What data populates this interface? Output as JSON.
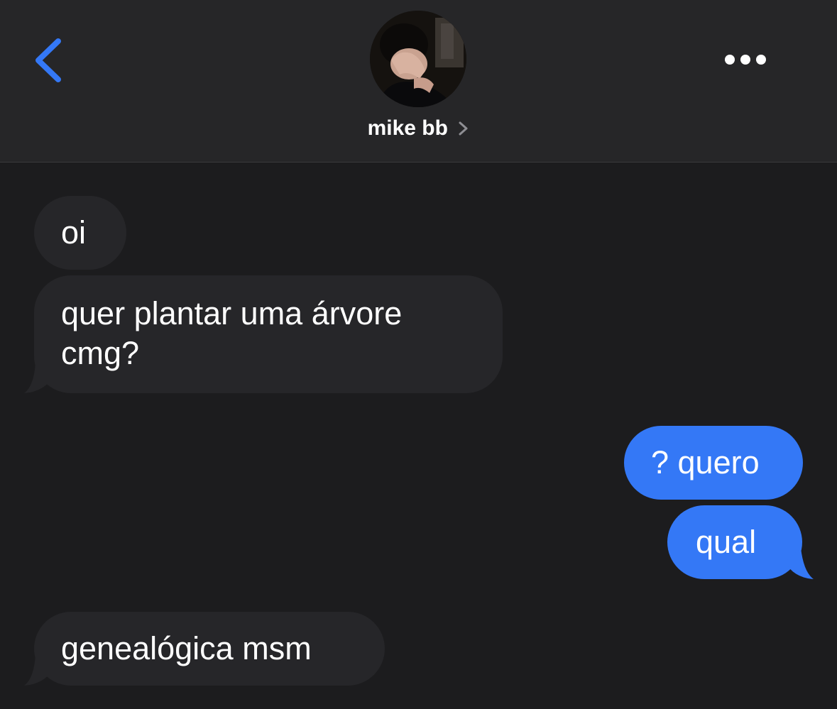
{
  "header": {
    "contact_name": "mike bb",
    "icons": {
      "back": "chevron-left-icon",
      "more": "ellipsis-icon",
      "name_chevron": "chevron-right-icon"
    }
  },
  "colors": {
    "background": "#1c1c1e",
    "header_background": "#262628",
    "incoming_bubble": "#262629",
    "outgoing_bubble": "#3478f6",
    "accent": "#3478f6",
    "text": "#ffffff"
  },
  "messages": [
    {
      "direction": "incoming",
      "text": "oi"
    },
    {
      "direction": "incoming",
      "text": "quer plantar uma árvore cmg?"
    },
    {
      "direction": "outgoing",
      "text": "? quero"
    },
    {
      "direction": "outgoing",
      "text": "qual"
    },
    {
      "direction": "incoming",
      "text": "genealógica msm"
    }
  ]
}
